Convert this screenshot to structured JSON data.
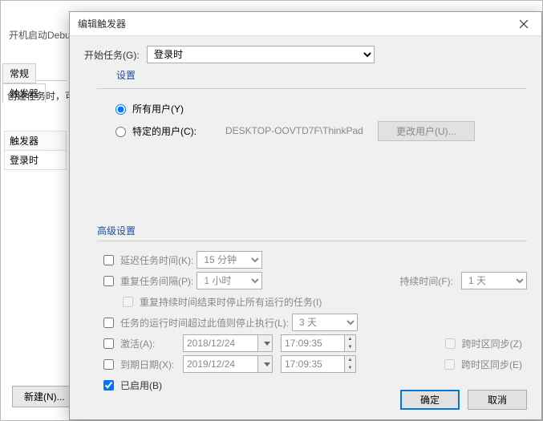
{
  "background": {
    "tab_label": "开机启动Debu",
    "tabs": {
      "general": "常规",
      "triggers": "触发器"
    },
    "help_text": "创建任务时，可",
    "trigger_header": "触发器",
    "trigger_row": "登录时",
    "new_button": "新建(N)..."
  },
  "dialog": {
    "title": "编辑触发器",
    "begin_task_label": "开始任务(G):",
    "begin_task_value": "登录时",
    "settings_title": "设置",
    "radio_all_users": "所有用户(Y)",
    "radio_specific_user": "特定的用户(C):",
    "specific_user_value": "DESKTOP-OOVTD7F\\ThinkPad",
    "change_user_btn": "更改用户(U)...",
    "advanced_title": "高级设置",
    "delay_label": "延迟任务时间(K):",
    "delay_value": "15 分钟",
    "repeat_label": "重复任务间隔(P):",
    "repeat_value": "1 小时",
    "duration_label": "持续时间(F):",
    "duration_value": "1 天",
    "stop_at_end_label": "重复持续时间结束时停止所有运行的任务(I)",
    "stop_longer_label": "任务的运行时间超过此值则停止执行(L):",
    "stop_longer_value": "3 天",
    "activate_label": "激活(A):",
    "activate_date": "2018/12/24",
    "activate_time": "17:09:35",
    "expire_label": "到期日期(X):",
    "expire_date": "2019/12/24",
    "expire_time": "17:09:35",
    "tz_sync_z": "跨时区同步(Z)",
    "tz_sync_e": "跨时区同步(E)",
    "enabled_label": "已启用(B)",
    "ok_btn": "确定",
    "cancel_btn": "取消"
  }
}
